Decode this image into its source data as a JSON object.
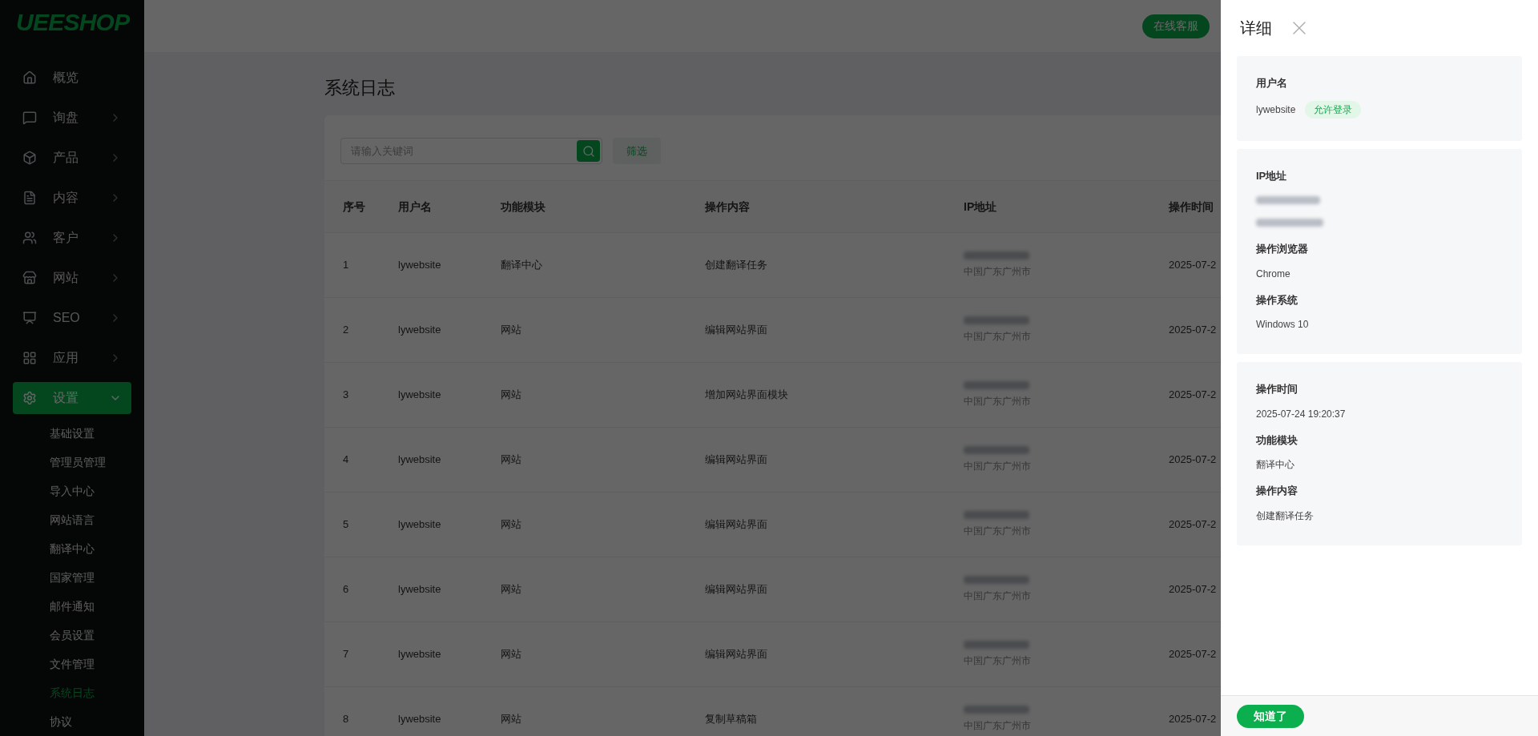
{
  "logo": "UEESHOP",
  "sidebar": {
    "items": [
      {
        "label": "概览",
        "kind": "link",
        "selected": false
      },
      {
        "label": "询盘",
        "kind": "group",
        "expanded": false,
        "selected": false
      },
      {
        "label": "产品",
        "kind": "group",
        "expanded": false,
        "selected": false
      },
      {
        "label": "内容",
        "kind": "group",
        "expanded": false,
        "selected": false
      },
      {
        "label": "客户",
        "kind": "group",
        "expanded": false,
        "selected": false
      },
      {
        "label": "网站",
        "kind": "group",
        "expanded": false,
        "selected": false
      },
      {
        "label": "SEO",
        "kind": "group",
        "expanded": false,
        "selected": false
      },
      {
        "label": "应用",
        "kind": "group",
        "expanded": false,
        "selected": false
      },
      {
        "label": "设置",
        "kind": "group",
        "expanded": true,
        "selected": true,
        "children": [
          {
            "label": "基础设置",
            "selected": false
          },
          {
            "label": "管理员管理",
            "selected": false
          },
          {
            "label": "导入中心",
            "selected": false
          },
          {
            "label": "网站语言",
            "selected": false
          },
          {
            "label": "翻译中心",
            "selected": false
          },
          {
            "label": "国家管理",
            "selected": false
          },
          {
            "label": "邮件通知",
            "selected": false
          },
          {
            "label": "会员设置",
            "selected": false
          },
          {
            "label": "文件管理",
            "selected": false
          },
          {
            "label": "系统日志",
            "selected": true
          },
          {
            "label": "协议",
            "selected": false
          }
        ]
      }
    ]
  },
  "top_bar": {
    "support_button": "在线客服"
  },
  "page": {
    "title": "系统日志",
    "search": {
      "placeholder": "请输入关键词"
    },
    "filter_button": "筛选"
  },
  "table": {
    "columns": [
      "序号",
      "用户名",
      "功能模块",
      "操作内容",
      "IP地址",
      "操作时间"
    ],
    "rows": [
      {
        "index": "1",
        "username": "lywebsite",
        "module": "翻译中心",
        "content": "创建翻译任务",
        "location": "中国广东广州市",
        "time": "2025-07-2"
      },
      {
        "index": "2",
        "username": "lywebsite",
        "module": "网站",
        "content": "编辑网站界面",
        "location": "中国广东广州市",
        "time": "2025-07-2"
      },
      {
        "index": "3",
        "username": "lywebsite",
        "module": "网站",
        "content": "增加网站界面模块",
        "location": "中国广东广州市",
        "time": "2025-07-2"
      },
      {
        "index": "4",
        "username": "lywebsite",
        "module": "网站",
        "content": "编辑网站界面",
        "location": "中国广东广州市",
        "time": "2025-07-2"
      },
      {
        "index": "5",
        "username": "lywebsite",
        "module": "网站",
        "content": "编辑网站界面",
        "location": "中国广东广州市",
        "time": "2025-07-2"
      },
      {
        "index": "6",
        "username": "lywebsite",
        "module": "网站",
        "content": "编辑网站界面",
        "location": "中国广东广州市",
        "time": "2025-07-2"
      },
      {
        "index": "7",
        "username": "lywebsite",
        "module": "网站",
        "content": "编辑网站界面",
        "location": "中国广东广州市",
        "time": "2025-07-2"
      },
      {
        "index": "8",
        "username": "lywebsite",
        "module": "网站",
        "content": "复制草稿箱",
        "location": "中国广东广州市",
        "time": "2025-07-2"
      }
    ]
  },
  "drawer": {
    "title": "详细",
    "sections": [
      {
        "fields": [
          {
            "label": "用户名",
            "kind": "text",
            "value": "lywebsite",
            "badge": "允许登录"
          }
        ]
      },
      {
        "fields": [
          {
            "label": "IP地址",
            "kind": "redacted"
          },
          {
            "label": "操作浏览器",
            "kind": "text",
            "value": "Chrome"
          },
          {
            "label": "操作系统",
            "kind": "text",
            "value": "Windows 10"
          }
        ]
      },
      {
        "fields": [
          {
            "label": "操作时间",
            "kind": "text",
            "value": "2025-07-24 19:20:37"
          },
          {
            "label": "功能模块",
            "kind": "text",
            "value": "翻译中心"
          },
          {
            "label": "操作内容",
            "kind": "text",
            "value": "创建翻译任务"
          }
        ]
      }
    ],
    "confirm_button": "知道了"
  }
}
